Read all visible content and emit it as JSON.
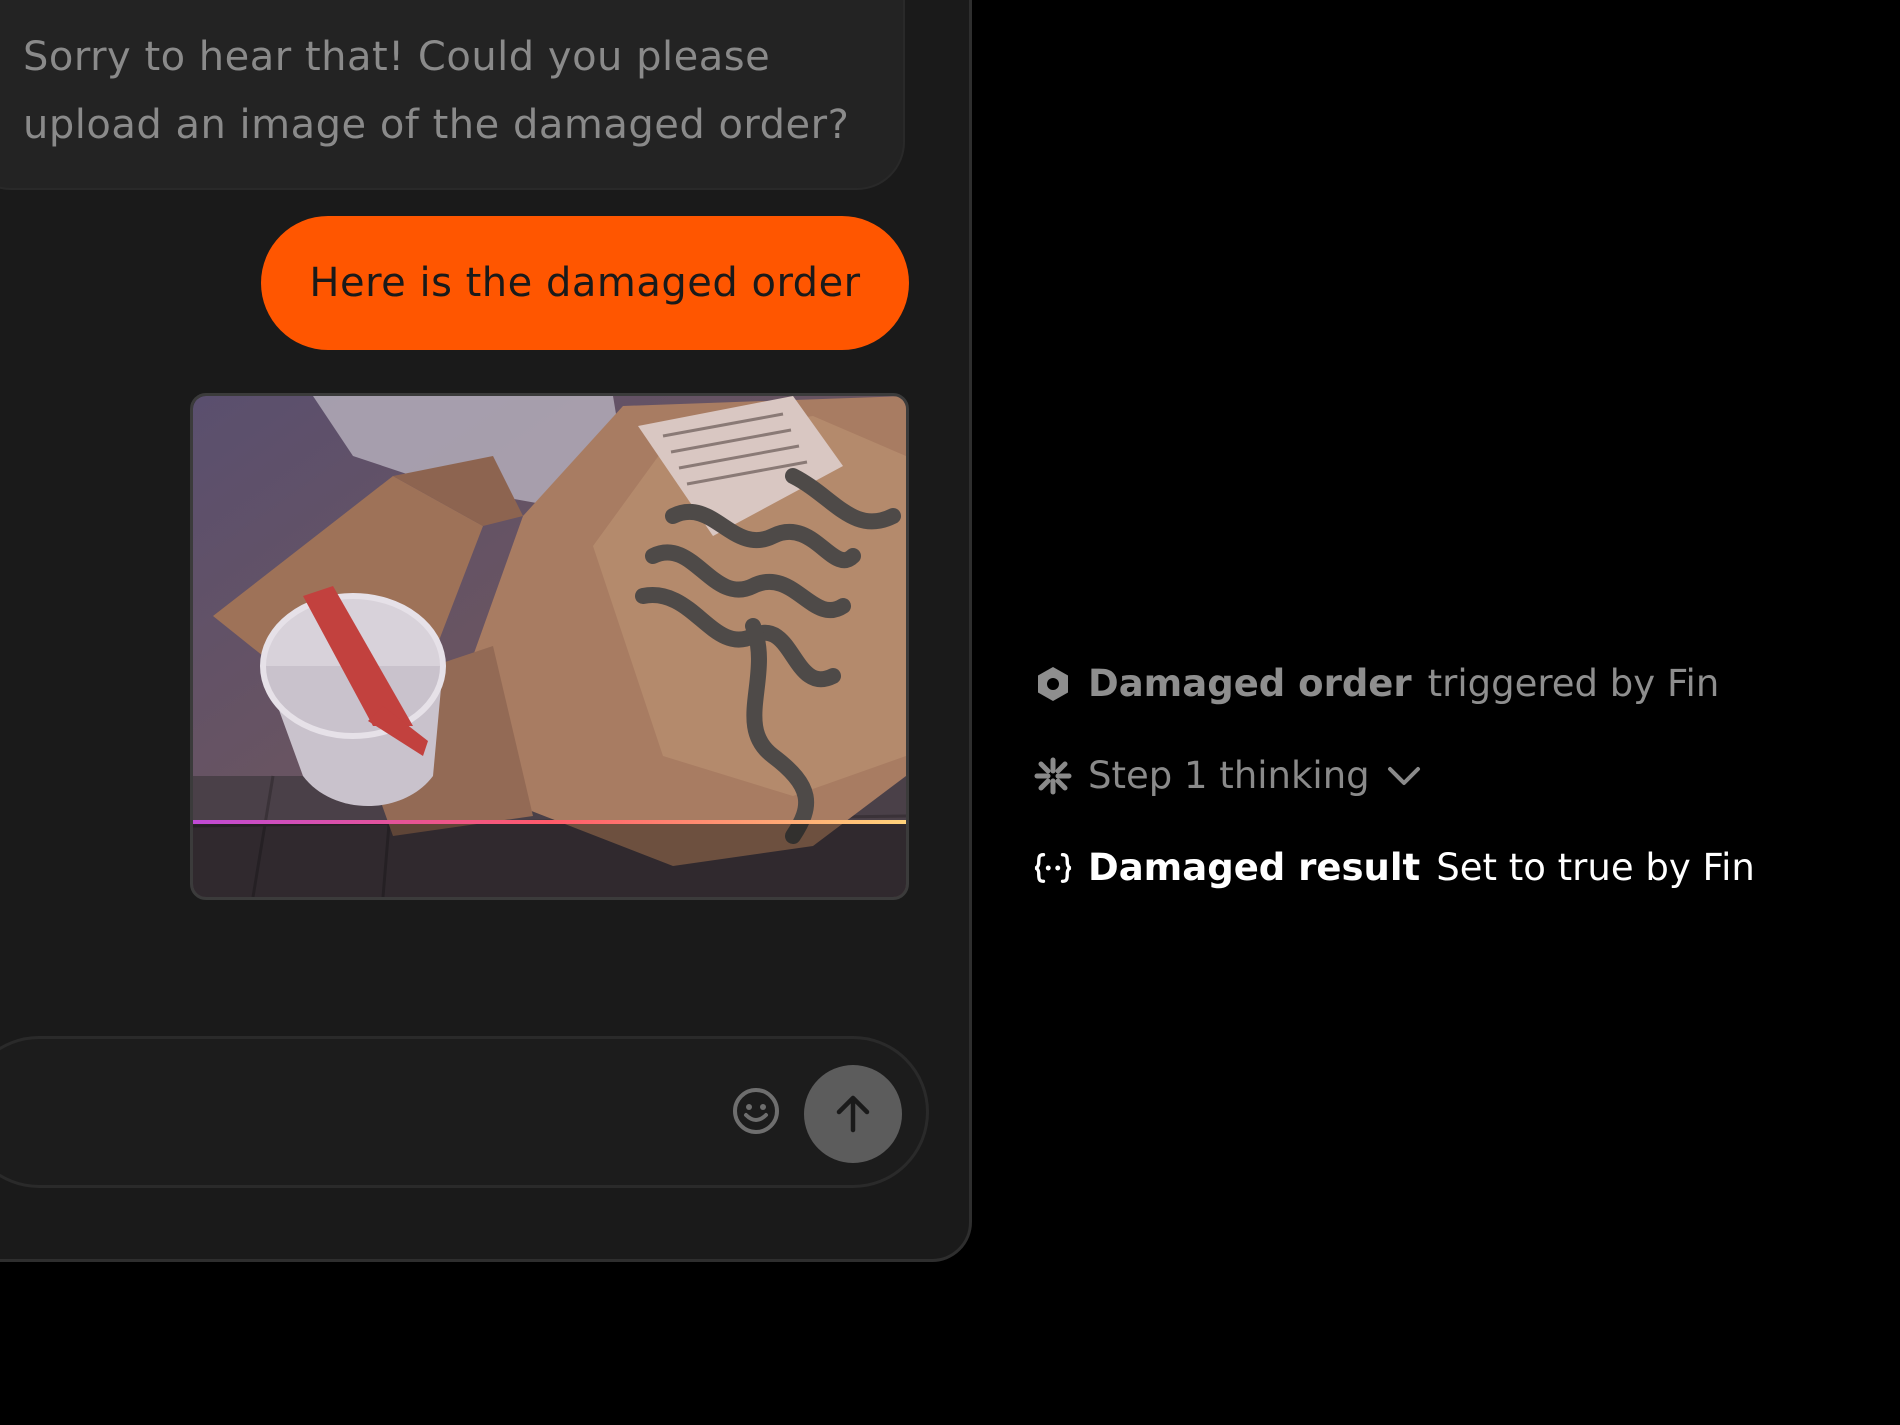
{
  "chat": {
    "bot_message": "Sorry to hear that! Could you please upload an image of the damaged order?",
    "user_message": "Here is the damaged order",
    "attachment_icon": "photo-of-damaged-food-bag",
    "composer": {
      "emoji_icon": "smiley-icon",
      "send_icon": "arrow-up-icon"
    }
  },
  "activity_log": {
    "row1": {
      "icon": "hexagon-icon",
      "title": "Damaged order",
      "detail": "triggered by Fin"
    },
    "row2": {
      "icon": "sparkle-icon",
      "label": "Step 1 thinking",
      "toggle_icon": "chevron-down-icon"
    },
    "row3": {
      "icon": "variable-braces-icon",
      "title": "Damaged result",
      "detail": "Set to true by Fin"
    }
  },
  "colors": {
    "accent": "#ff5600",
    "background": "#000000",
    "panel": "#1a1a1a"
  }
}
